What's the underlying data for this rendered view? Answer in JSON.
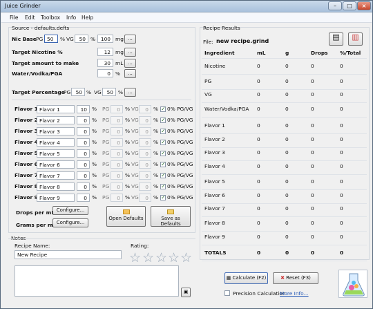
{
  "window": {
    "title": "Juice Grinder"
  },
  "menu": [
    "File",
    "Edit",
    "Toolbox",
    "Info",
    "Help"
  ],
  "source": {
    "title": "Source - defaults.defts"
  },
  "nic_base": {
    "label": "Nic Base",
    "pg_label": "PG",
    "pg_value": "50",
    "pct1": "%",
    "vg_label": "VG",
    "vg_value": "50",
    "pct2": "%",
    "strength": "100",
    "unit": "mg",
    "button": "..."
  },
  "target_nicotine": {
    "label": "Target Nicotine %",
    "value": "12",
    "unit": "mg",
    "button": "..."
  },
  "target_amount": {
    "label": "Target amount to make",
    "value": "30",
    "unit": "mL",
    "button": "..."
  },
  "water": {
    "label": "Water/Vodka/PGA",
    "value": "0",
    "unit": "%",
    "button": "..."
  },
  "target_percentage": {
    "label": "Target Percentage",
    "pg_label": "PG",
    "pg_value": "50",
    "pct1": "%",
    "vg_label": "VG",
    "vg_value": "50",
    "pct2": "%",
    "button": "..."
  },
  "flavors": [
    {
      "label": "Flavor 1",
      "name": "Flavor 1",
      "amount": "10",
      "pct": "%",
      "pg_label": "PG",
      "pg_value": "0",
      "pct2": "%",
      "vg_label": "VG",
      "vg_value": "0",
      "pct3": "%",
      "check_label": "0% PG/VG"
    },
    {
      "label": "Flavor 2",
      "name": "Flavor 2",
      "amount": "0",
      "pct": "%",
      "pg_label": "PG",
      "pg_value": "0",
      "pct2": "%",
      "vg_label": "VG",
      "vg_value": "0",
      "pct3": "%",
      "check_label": "0% PG/VG"
    },
    {
      "label": "Flavor 3",
      "name": "Flavor 3",
      "amount": "0",
      "pct": "%",
      "pg_label": "PG",
      "pg_value": "0",
      "pct2": "%",
      "vg_label": "VG",
      "vg_value": "0",
      "pct3": "%",
      "check_label": "0% PG/VG"
    },
    {
      "label": "Flavor 4",
      "name": "Flavor 4",
      "amount": "0",
      "pct": "%",
      "pg_label": "PG",
      "pg_value": "0",
      "pct2": "%",
      "vg_label": "VG",
      "vg_value": "0",
      "pct3": "%",
      "check_label": "0% PG/VG"
    },
    {
      "label": "Flavor 5",
      "name": "Flavor 5",
      "amount": "0",
      "pct": "%",
      "pg_label": "PG",
      "pg_value": "0",
      "pct2": "%",
      "vg_label": "VG",
      "vg_value": "0",
      "pct3": "%",
      "check_label": "0% PG/VG"
    },
    {
      "label": "Flavor 6",
      "name": "Flavor 6",
      "amount": "0",
      "pct": "%",
      "pg_label": "PG",
      "pg_value": "0",
      "pct2": "%",
      "vg_label": "VG",
      "vg_value": "0",
      "pct3": "%",
      "check_label": "0% PG/VG"
    },
    {
      "label": "Flavor 7",
      "name": "Flavor 7",
      "amount": "0",
      "pct": "%",
      "pg_label": "PG",
      "pg_value": "0",
      "pct2": "%",
      "vg_label": "VG",
      "vg_value": "0",
      "pct3": "%",
      "check_label": "0% PG/VG"
    },
    {
      "label": "Flavor 8",
      "name": "Flavor 8",
      "amount": "0",
      "pct": "%",
      "pg_label": "PG",
      "pg_value": "0",
      "pct2": "%",
      "vg_label": "VG",
      "vg_value": "0",
      "pct3": "%",
      "check_label": "0% PG/VG"
    },
    {
      "label": "Flavor 9",
      "name": "Flavor 9",
      "amount": "0",
      "pct": "%",
      "pg_label": "PG",
      "pg_value": "0",
      "pct2": "%",
      "vg_label": "VG",
      "vg_value": "0",
      "pct3": "%",
      "check_label": "0% PG/VG"
    }
  ],
  "drops": {
    "label": "Drops per mL",
    "button": "Configure..."
  },
  "grams": {
    "label": "Grams per mL",
    "button": "Configure..."
  },
  "buttons": {
    "open_defaults": "Open Defaults",
    "save_defaults": "Save as Defaults",
    "calculate": "Calculate (F2)",
    "reset": "Reset (F3)"
  },
  "notes": {
    "title": "Notes",
    "recipe_label": "Recipe Name:",
    "recipe_value": "New Recipe",
    "rating_label": "Rating:"
  },
  "results": {
    "title": "Recipe Results",
    "file_label": "File:",
    "file_name": "new recipe.grind",
    "headers": [
      "Ingredient",
      "mL",
      "g",
      "Drops",
      "%/Total"
    ],
    "rows": [
      [
        "Nicotine",
        "0",
        "0",
        "0",
        "0"
      ],
      [
        "PG",
        "0",
        "0",
        "0",
        "0"
      ],
      [
        "VG",
        "0",
        "0",
        "0",
        "0"
      ],
      [
        "Water/Vodka/PGA",
        "0",
        "0",
        "0",
        "0"
      ],
      [
        "Flavor 1",
        "0",
        "0",
        "0",
        "0"
      ],
      [
        "Flavor 2",
        "0",
        "0",
        "0",
        "0"
      ],
      [
        "Flavor 3",
        "0",
        "0",
        "0",
        "0"
      ],
      [
        "Flavor 4",
        "0",
        "0",
        "0",
        "0"
      ],
      [
        "Flavor 5",
        "0",
        "0",
        "0",
        "0"
      ],
      [
        "Flavor 6",
        "0",
        "0",
        "0",
        "0"
      ],
      [
        "Flavor 7",
        "0",
        "0",
        "0",
        "0"
      ],
      [
        "Flavor 8",
        "0",
        "0",
        "0",
        "0"
      ],
      [
        "Flavor 9",
        "0",
        "0",
        "0",
        "0"
      ],
      [
        "TOTALS",
        "0",
        "0",
        "0",
        "0"
      ]
    ]
  },
  "precision_label": "Precision Calculation",
  "more_info": "More Info...",
  "colors": {
    "accent": "#3b66b3",
    "title": "#a9c1dc"
  },
  "icons": [
    "minimize-icon",
    "maximize-icon",
    "close-icon",
    "document-icon",
    "chart-icon",
    "folder-icon",
    "save-icon",
    "calculator-icon",
    "reset-icon",
    "flask-icon",
    "star-icon"
  ]
}
